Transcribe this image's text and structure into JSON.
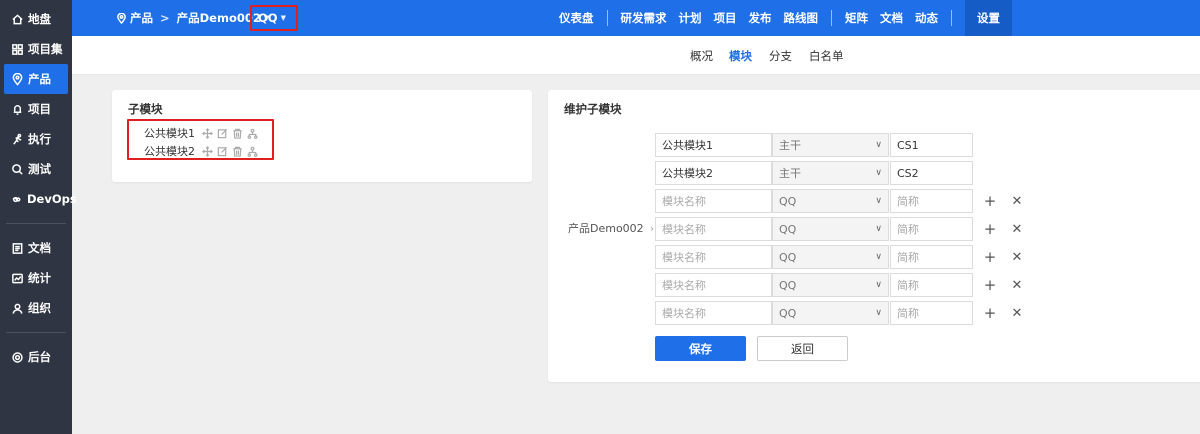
{
  "sidebar": {
    "items": [
      {
        "label": "地盘",
        "icon": "home-icon"
      },
      {
        "label": "项目集",
        "icon": "grid-icon"
      },
      {
        "label": "产品",
        "icon": "product-pin-icon",
        "active": true
      },
      {
        "label": "项目",
        "icon": "bell-icon"
      },
      {
        "label": "执行",
        "icon": "runner-icon"
      },
      {
        "label": "测试",
        "icon": "search-check-icon"
      },
      {
        "label": "DevOps",
        "icon": "infinity-icon"
      }
    ],
    "items2": [
      {
        "label": "文档",
        "icon": "document-icon"
      },
      {
        "label": "统计",
        "icon": "chart-icon"
      },
      {
        "label": "组织",
        "icon": "user-icon"
      }
    ],
    "items3": [
      {
        "label": "后台",
        "icon": "gear-icon"
      }
    ]
  },
  "topbar": {
    "breadcrumb": {
      "root": "产品",
      "product": "产品Demo002",
      "branch": "QQ"
    },
    "nav": [
      "仪表盘",
      "研发需求",
      "计划",
      "项目",
      "发布",
      "路线图",
      "矩阵",
      "文档",
      "动态",
      "设置"
    ],
    "active_nav": "设置"
  },
  "subnav": {
    "tabs": [
      "概况",
      "模块",
      "分支",
      "白名单"
    ],
    "active": "模块"
  },
  "left_panel": {
    "title": "子模块",
    "modules": [
      "公共模块1",
      "公共模块2"
    ]
  },
  "right_panel": {
    "title": "维护子模块",
    "parent": "产品Demo002",
    "rows": [
      {
        "name": "公共模块1",
        "branch": "主干",
        "short": "CS1",
        "is_new": false
      },
      {
        "name": "公共模块2",
        "branch": "主干",
        "short": "CS2",
        "is_new": false
      },
      {
        "name": "",
        "branch": "QQ",
        "short": "",
        "is_new": true
      },
      {
        "name": "",
        "branch": "QQ",
        "short": "",
        "is_new": true
      },
      {
        "name": "",
        "branch": "QQ",
        "short": "",
        "is_new": true
      },
      {
        "name": "",
        "branch": "QQ",
        "short": "",
        "is_new": true
      },
      {
        "name": "",
        "branch": "QQ",
        "short": "",
        "is_new": true
      }
    ],
    "name_placeholder": "模块名称",
    "short_placeholder": "简称",
    "save_label": "保存",
    "back_label": "返回"
  },
  "colors": {
    "primary": "#1e6fe8",
    "sidebar": "#2f3542",
    "highlight": "#e02020"
  }
}
